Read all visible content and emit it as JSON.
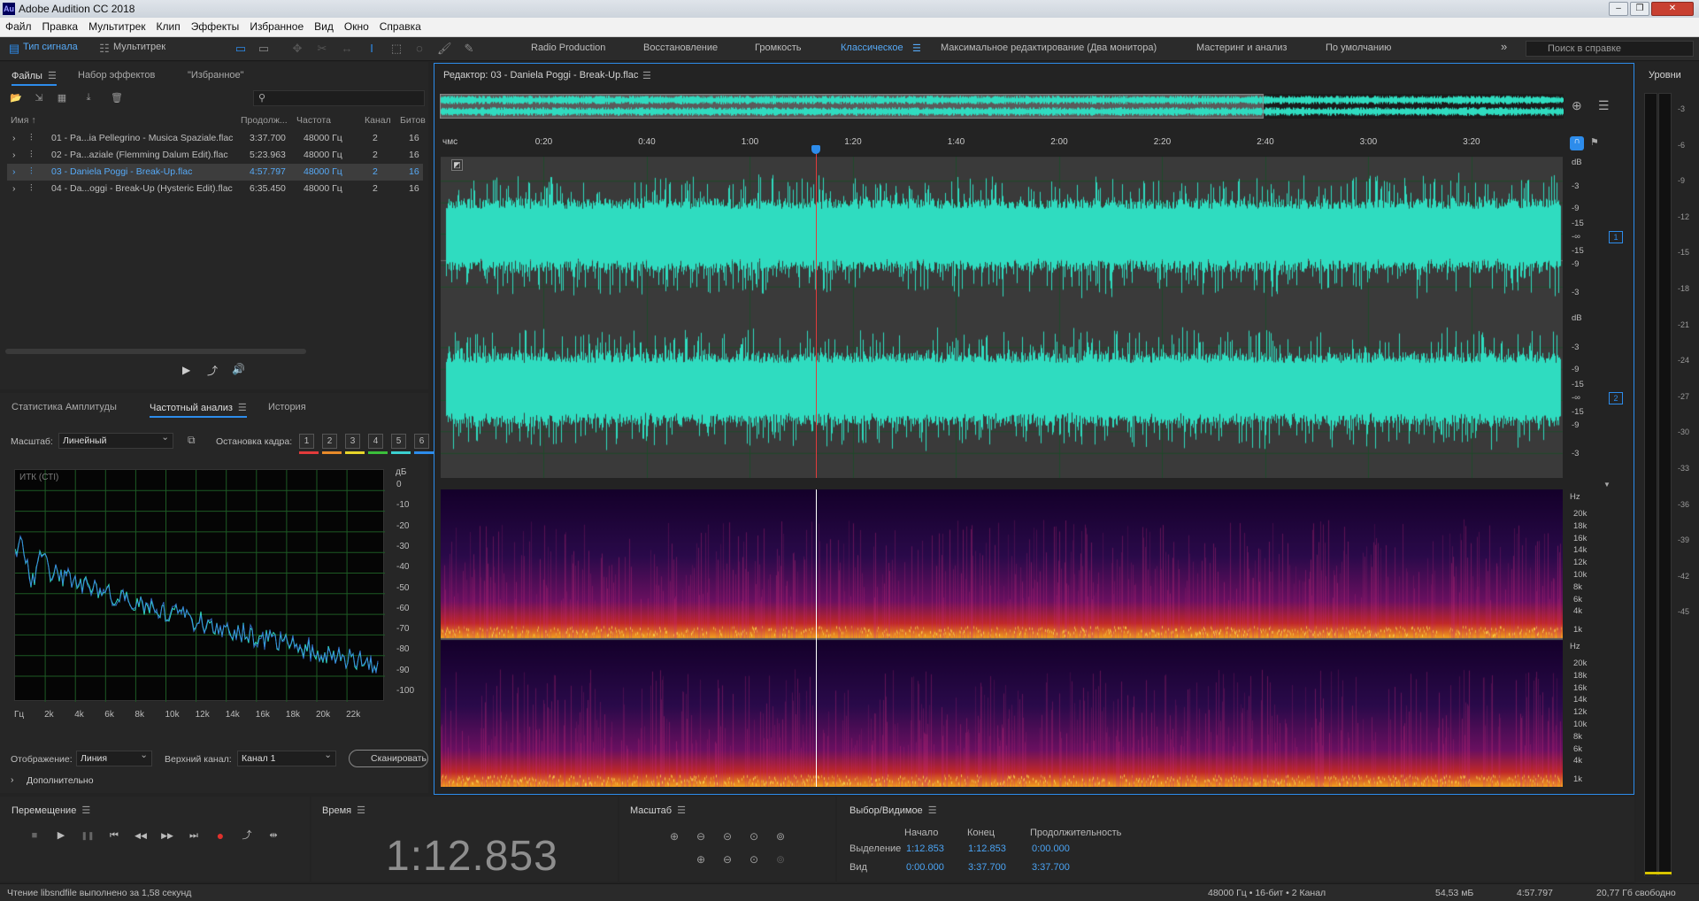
{
  "window": {
    "title": "Adobe Audition CC 2018",
    "logo": "Au",
    "min": "‒",
    "max": "❐",
    "close": "✕"
  },
  "menu": [
    "Файл",
    "Правка",
    "Мультитрек",
    "Клип",
    "Эффекты",
    "Избранное",
    "Вид",
    "Окно",
    "Справка"
  ],
  "toolbar": {
    "mode_waveform": "Тип сигнала",
    "mode_multitrack": "Мультитрек",
    "workspaces": [
      "Radio Production",
      "Восстановление",
      "Громкость",
      "Классическое",
      "Максимальное редактирование (Два монитора)",
      "Мастеринг и анализ",
      "По умолчанию"
    ],
    "active_workspace": "Классическое",
    "more": "»",
    "search_placeholder": "Поиск в справке"
  },
  "files_panel": {
    "tabs": [
      "Файлы",
      "Набор эффектов",
      "\"Избранное\""
    ],
    "search_icon": "⚲",
    "columns": [
      "Имя ↑",
      "Продолж...",
      "Частота",
      "Канал",
      "Битов"
    ],
    "rows": [
      {
        "expander": "›",
        "name": "01 - Pa...ia Pellegrino - Musica Spaziale.flac",
        "duration": "3:37.700",
        "rate": "48000 Гц",
        "channels": "2",
        "bits": "16"
      },
      {
        "expander": "›",
        "name": "02 - Pa...aziale (Flemming Dalum Edit).flac",
        "duration": "5:23.963",
        "rate": "48000 Гц",
        "channels": "2",
        "bits": "16"
      },
      {
        "expander": "›",
        "name": "03 - Daniela Poggi - Break-Up.flac",
        "duration": "4:57.797",
        "rate": "48000 Гц",
        "channels": "2",
        "bits": "16"
      },
      {
        "expander": "›",
        "name": "04 - Da...oggi - Break-Up (Hysteric Edit).flac",
        "duration": "6:35.450",
        "rate": "48000 Гц",
        "channels": "2",
        "bits": "16"
      }
    ],
    "selected_index": 2
  },
  "analysis_panel": {
    "tabs": [
      "Статистика Амплитуды",
      "Частотный анализ",
      "История"
    ],
    "scale_label": "Масштаб:",
    "scale_value": "Линейный",
    "hold_label": "Остановка кадра:",
    "frames": [
      "1",
      "2",
      "3",
      "4",
      "5",
      "6"
    ],
    "frame_colors": [
      "#e23b3b",
      "#e88a2a",
      "#e8d52a",
      "#3bbf3b",
      "#3bd0d0",
      "#2d8ceb"
    ],
    "graph_label": "ИТК (СТI)",
    "db_unit": "дБ",
    "db_ticks": [
      "0",
      "-10",
      "-20",
      "-30",
      "-40",
      "-50",
      "-60",
      "-70",
      "-80",
      "-90",
      "-100"
    ],
    "hz_ticks": [
      "Гц",
      "2k",
      "4k",
      "6k",
      "8k",
      "10k",
      "12k",
      "14k",
      "16k",
      "18k",
      "20k",
      "22k"
    ],
    "display_label": "Отображение:",
    "display_value": "Линия",
    "channel_label": "Верхний канал:",
    "channel_value": "Канал 1",
    "scan_button": "Сканировать",
    "advanced": "Дополнительно"
  },
  "editor": {
    "title": "Редактор: 03 - Daniela Poggi - Break-Up.flac",
    "time_unit": "чмс",
    "time_ticks": [
      "0:20",
      "0:40",
      "1:00",
      "1:20",
      "1:40",
      "2:00",
      "2:20",
      "2:40",
      "3:00",
      "3:20"
    ],
    "playhead_seconds": 72.853,
    "visible_seconds": 217.7,
    "db_unit": "dB",
    "db_labels": [
      "-3",
      "-9",
      "-15",
      "-∞",
      "-15",
      "-9",
      "-3"
    ],
    "channels": [
      "1",
      "2"
    ],
    "hz_unit": "Hz",
    "hz_labels": [
      "20k",
      "18k",
      "16k",
      "14k",
      "12k",
      "10k",
      "8k",
      "6k",
      "4k",
      "1k"
    ],
    "waveform_color": "#2fdcc0",
    "accent": "#2d8ceb"
  },
  "levels": {
    "title": "Уровни",
    "scale": [
      "-3",
      "-6",
      "-9",
      "-12",
      "-15",
      "-18",
      "-21",
      "-24",
      "-27",
      "-30",
      "-33",
      "-36",
      "-39",
      "-42",
      "-45"
    ]
  },
  "transport": {
    "title": "Перемещение",
    "buttons": [
      "■",
      "▶",
      "❚❚",
      "⏮",
      "◀◀",
      "▶▶",
      "⏭",
      "●",
      "⤴",
      "⇹"
    ]
  },
  "time_panel": {
    "title": "Время",
    "value": "1:12.853"
  },
  "zoom_panel": {
    "title": "Масштаб"
  },
  "selection_panel": {
    "title": "Выбор/Видимое",
    "headers": [
      "Начало",
      "Конец",
      "Продолжительность"
    ],
    "selection": {
      "label": "Выделение",
      "start": "1:12.853",
      "end": "1:12.853",
      "duration": "0:00.000"
    },
    "view": {
      "label": "Вид",
      "start": "0:00.000",
      "end": "3:37.700",
      "duration": "3:37.700"
    }
  },
  "status": {
    "message": "Чтение libsndfile выполнено за 1,58 секунд",
    "format": "48000 Гц • 16-бит • 2 Канал",
    "size": "54,53 мБ",
    "duration": "4:57.797",
    "free": "20,77 Гб свободно"
  }
}
